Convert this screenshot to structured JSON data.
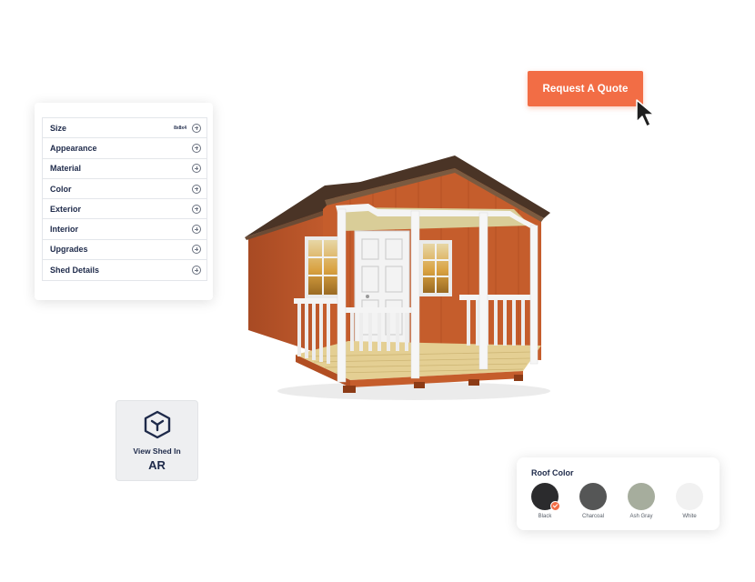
{
  "options_panel": {
    "items": [
      {
        "label": "Size",
        "value": "8x8x4"
      },
      {
        "label": "Appearance"
      },
      {
        "label": "Material"
      },
      {
        "label": "Color"
      },
      {
        "label": "Exterior"
      },
      {
        "label": "Interior"
      },
      {
        "label": "Upgrades"
      },
      {
        "label": "Shed Details"
      }
    ]
  },
  "cta": {
    "quote_label": "Request A Quote"
  },
  "ar_card": {
    "line1": "View Shed In",
    "line2": "AR"
  },
  "roof_color": {
    "title": "Roof Color",
    "selected": "Black",
    "swatches": [
      {
        "label": "Black",
        "color": "#2b2b2d"
      },
      {
        "label": "Charcoal",
        "color": "#555656"
      },
      {
        "label": "Ash Gray",
        "color": "#a6ad9d"
      },
      {
        "label": "White",
        "color": "#f1f1f1"
      }
    ]
  },
  "colors": {
    "accent": "#f26d45",
    "navy": "#1e2a4a"
  }
}
